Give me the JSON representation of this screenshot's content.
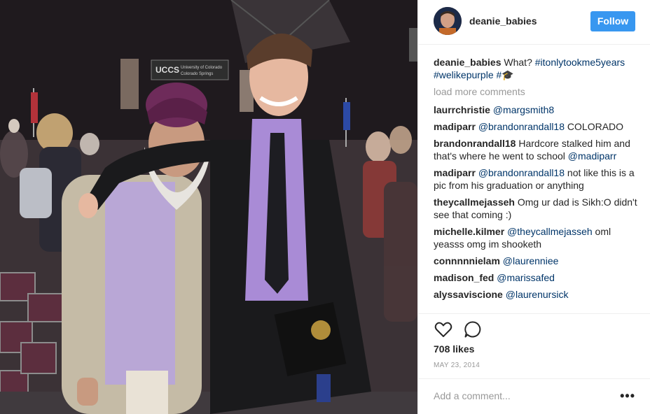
{
  "post": {
    "author": "deanie_babies",
    "follow_label": "Follow",
    "caption_text": "What? ",
    "caption_tags": "#itonlytookme5years #welikepurple #",
    "caption_emoji": "🎓",
    "load_more": "load more comments",
    "likes": "708 likes",
    "date": "MAY 23, 2014",
    "add_comment_placeholder": "Add a comment...",
    "more_options": "•••"
  },
  "comments": [
    {
      "user": "laurrchristie",
      "mention": "@margsmith8",
      "text": ""
    },
    {
      "user": "madiparr",
      "mention": "@brandonrandall18",
      "text": " COLORADO"
    },
    {
      "user": "brandonrandall18",
      "mention": "",
      "text": "Hardcore stalked him and that's where he went to school ",
      "mention2": "@madiparr"
    },
    {
      "user": "madiparr",
      "mention": "@brandonrandall18",
      "text": " not like this is a pic from his graduation or anything"
    },
    {
      "user": "theycallmejasseh",
      "mention": "",
      "text": "Omg ur dad is Sikh:O didn't see that coming :)"
    },
    {
      "user": "michelle.kilmer",
      "mention": "@theycallmejasseh",
      "text": " oml yeasss omg im shooketh"
    },
    {
      "user": "connnnnielam",
      "mention": "@laurenniee",
      "text": ""
    },
    {
      "user": "madison_fed",
      "mention": "@marissafed",
      "text": ""
    },
    {
      "user": "alyssaviscione",
      "mention": "@laurenursick",
      "text": ""
    }
  ],
  "photo_sign": {
    "logo": "UCCS",
    "line1": "University of Colorado",
    "line2": "Colorado Springs"
  },
  "icons": {
    "like": "heart-icon",
    "comment": "comment-icon",
    "more": "more-options-icon"
  },
  "colors": {
    "follow_blue": "#3897f0",
    "mention_blue": "#003569",
    "muted": "#999999"
  }
}
